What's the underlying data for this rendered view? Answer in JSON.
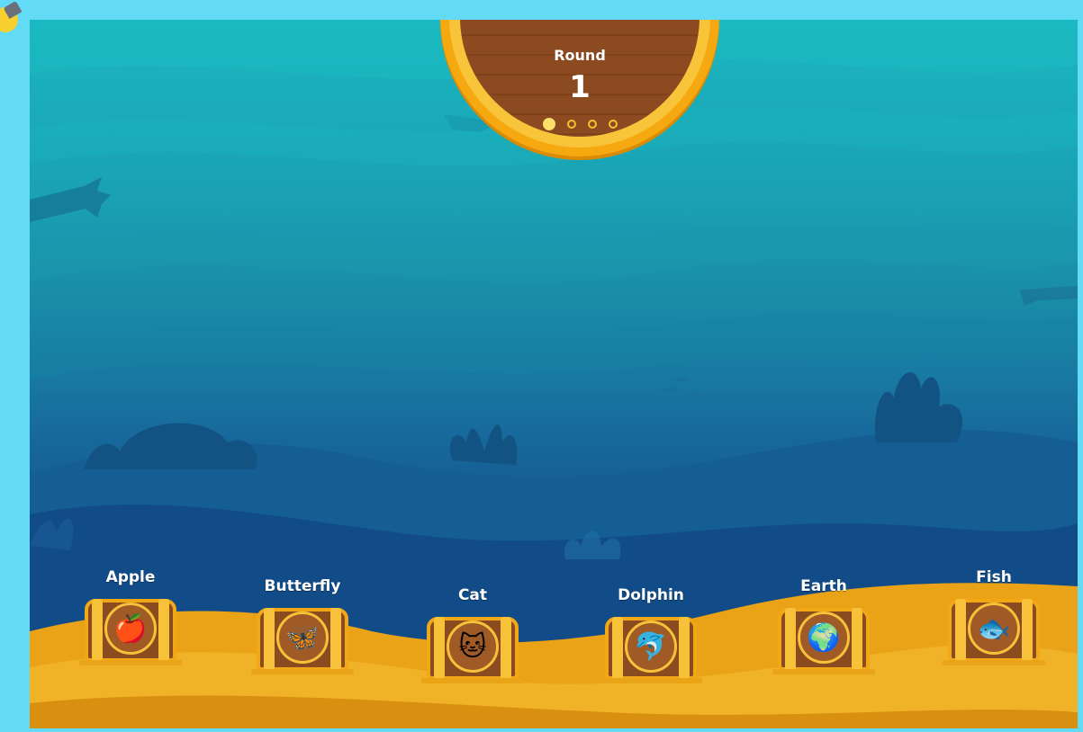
{
  "round": {
    "label": "Round",
    "number": "1",
    "total_rounds": 4,
    "current_index": 0
  },
  "chests": [
    {
      "label": "Apple",
      "icon": "apple-icon",
      "glyph": "🍎"
    },
    {
      "label": "Butterfly",
      "icon": "butterfly-icon",
      "glyph": "🦋"
    },
    {
      "label": "Cat",
      "icon": "cat-icon",
      "glyph": "🐱"
    },
    {
      "label": "Dolphin",
      "icon": "dolphin-icon",
      "glyph": "🐬"
    },
    {
      "label": "Earth",
      "icon": "earth-icon",
      "glyph": "🌍"
    },
    {
      "label": "Fish",
      "icon": "fish-icon",
      "glyph": "🐟"
    }
  ],
  "colors": {
    "frame": "#63dbf7",
    "sand": "#eaa317",
    "wood": "#8a4b1f",
    "gold": "#f5a80f"
  }
}
